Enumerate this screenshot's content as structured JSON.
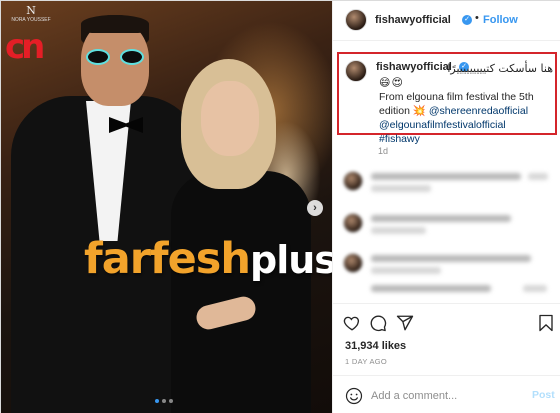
{
  "photo": {
    "watermark_colored": "farfesh",
    "watermark_white": "plus.com",
    "logo_text": "cn",
    "monogram": "N",
    "monogram_caption": "NORA YOUSSEF",
    "carousel_next_icon": "chevron-right",
    "carousel_dot_count": 3,
    "carousel_active_index": 0
  },
  "header": {
    "username": "fishawyofficial",
    "verified": true,
    "separator": "•",
    "follow_label": "Follow"
  },
  "caption": {
    "username": "fishawyofficial",
    "arabic_text": "هنا سأسكت كتيييييييييرًا",
    "emojis": "😄😍",
    "line1": "From elgouna film festival the 5th",
    "line2_prefix": "edition",
    "line2_emoji": "💥",
    "mention1": "@shereenredaofficial",
    "mention2": "@elgounafilmfestivalofficial",
    "hashtag": "#fishawy",
    "highlight_color": "#d4252b"
  },
  "timestamps": {
    "caption_age": "1d",
    "post_age": "1 DAY AGO"
  },
  "stats": {
    "likes": "31,934 likes"
  },
  "actions": {
    "like_icon": "heart-icon",
    "comment_icon": "comment-icon",
    "share_icon": "share-icon",
    "save_icon": "bookmark-icon"
  },
  "add_comment": {
    "placeholder": "Add a comment...",
    "post_label": "Post"
  },
  "colors": {
    "accent_blue": "#3897f0",
    "link_blue": "#00376b",
    "muted": "#8e8e8e"
  }
}
